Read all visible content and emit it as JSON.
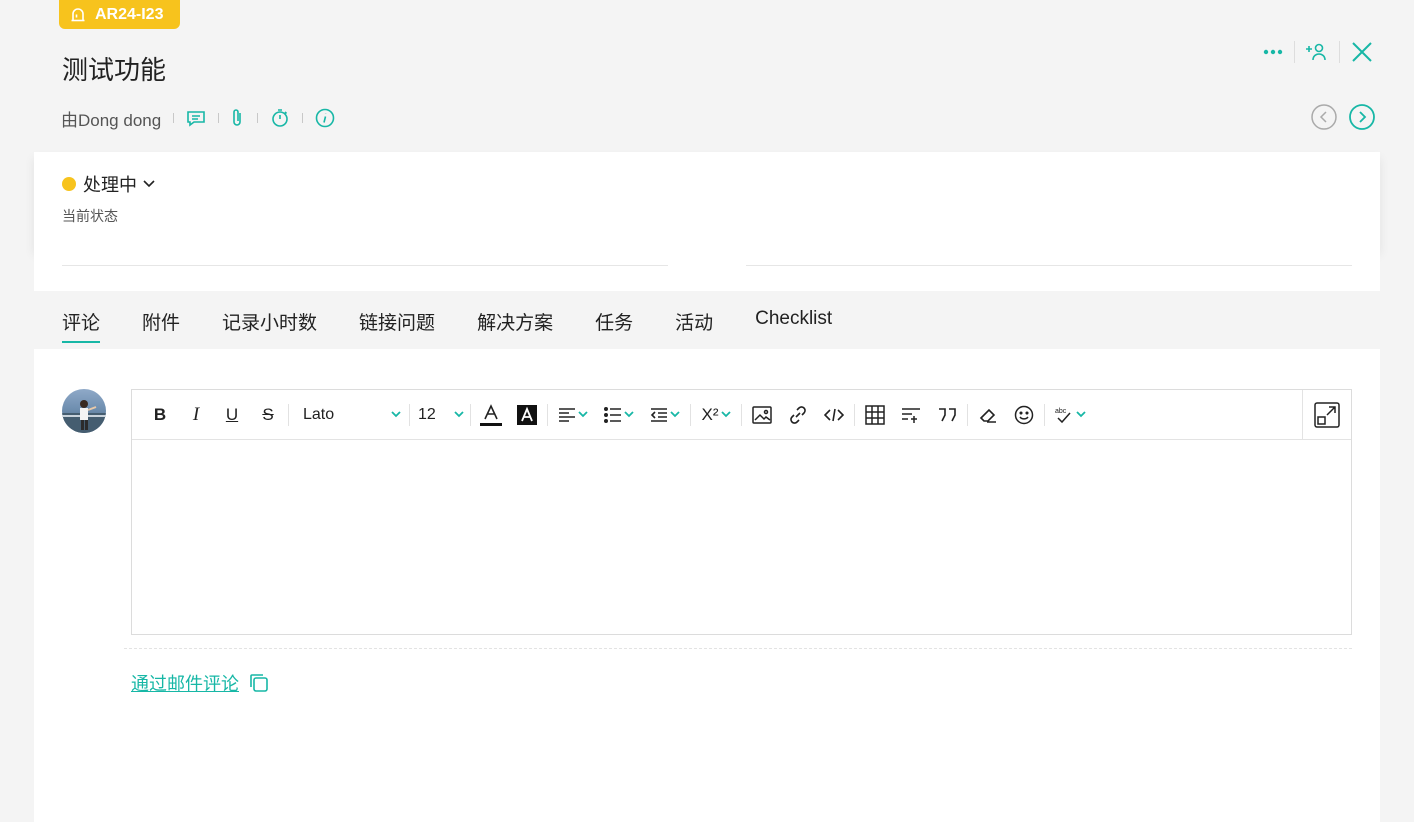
{
  "ticket": {
    "id": "AR24-I23",
    "title": "测试功能",
    "author": "由Dong dong"
  },
  "status": {
    "label": "处理中",
    "caption": "当前状态",
    "color": "#f7c31d"
  },
  "tabs": [
    {
      "label": "评论",
      "active": true
    },
    {
      "label": "附件"
    },
    {
      "label": "记录小时数"
    },
    {
      "label": "链接问题"
    },
    {
      "label": "解决方案"
    },
    {
      "label": "任务"
    },
    {
      "label": "活动"
    },
    {
      "label": "Checklist"
    }
  ],
  "editor": {
    "font_family": "Lato",
    "font_size": "12"
  },
  "footer": {
    "email_comment": "通过邮件评论"
  },
  "theme": {
    "accent": "#17b7a6",
    "badge": "#f7c31d"
  }
}
